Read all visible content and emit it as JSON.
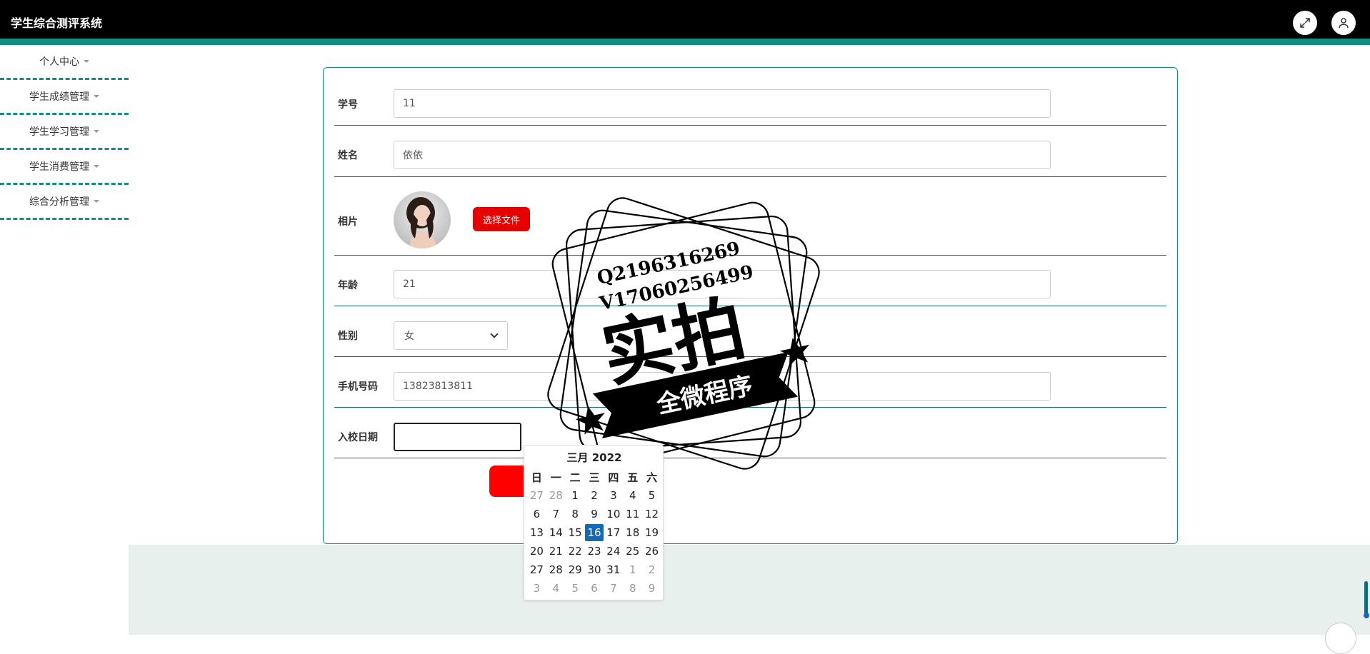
{
  "app": {
    "title": "学生综合测评系统"
  },
  "header": {
    "fullscreen_icon": "fullscreen-icon",
    "user_icon": "user-icon"
  },
  "sidebar": {
    "items": [
      {
        "label": "个人中心"
      },
      {
        "label": "学生成绩管理"
      },
      {
        "label": "学生学习管理"
      },
      {
        "label": "学生消费管理"
      },
      {
        "label": "综合分析管理"
      }
    ]
  },
  "form": {
    "student_id": {
      "label": "学号",
      "value": "11"
    },
    "name": {
      "label": "姓名",
      "value": "依依"
    },
    "photo": {
      "label": "相片",
      "button": "选择文件"
    },
    "age": {
      "label": "年龄",
      "value": "21"
    },
    "gender": {
      "label": "性别",
      "value": "女"
    },
    "phone": {
      "label": "手机号码",
      "value": "13823813811"
    },
    "enroll_date": {
      "label": "入校日期",
      "value": ""
    }
  },
  "calendar": {
    "header": "三月 2022",
    "weekdays": [
      "日",
      "一",
      "二",
      "三",
      "四",
      "五",
      "六"
    ],
    "weeks": [
      [
        {
          "d": "27",
          "m": true
        },
        {
          "d": "28",
          "m": true
        },
        {
          "d": "1"
        },
        {
          "d": "2"
        },
        {
          "d": "3"
        },
        {
          "d": "4"
        },
        {
          "d": "5"
        }
      ],
      [
        {
          "d": "6"
        },
        {
          "d": "7"
        },
        {
          "d": "8"
        },
        {
          "d": "9"
        },
        {
          "d": "10"
        },
        {
          "d": "11"
        },
        {
          "d": "12"
        }
      ],
      [
        {
          "d": "13"
        },
        {
          "d": "14"
        },
        {
          "d": "15"
        },
        {
          "d": "16",
          "s": true
        },
        {
          "d": "17"
        },
        {
          "d": "18"
        },
        {
          "d": "19"
        }
      ],
      [
        {
          "d": "20"
        },
        {
          "d": "21"
        },
        {
          "d": "22"
        },
        {
          "d": "23"
        },
        {
          "d": "24"
        },
        {
          "d": "25"
        },
        {
          "d": "26"
        }
      ],
      [
        {
          "d": "27"
        },
        {
          "d": "28"
        },
        {
          "d": "29"
        },
        {
          "d": "30"
        },
        {
          "d": "31"
        },
        {
          "d": "1",
          "m": true
        },
        {
          "d": "2",
          "m": true
        }
      ],
      [
        {
          "d": "3",
          "m": true
        },
        {
          "d": "4",
          "m": true
        },
        {
          "d": "5",
          "m": true
        },
        {
          "d": "6",
          "m": true
        },
        {
          "d": "7",
          "m": true
        },
        {
          "d": "8",
          "m": true
        },
        {
          "d": "9",
          "m": true
        }
      ]
    ]
  },
  "watermark": {
    "line1": "Q2196316269",
    "line2": "V17060256499",
    "main": "实拍",
    "ribbon": "全微程序"
  },
  "colors": {
    "accent": "#0f8e86",
    "button_red": "#e60000",
    "selected_date": "#1769b5",
    "footer_bg": "#e7f0ec"
  }
}
